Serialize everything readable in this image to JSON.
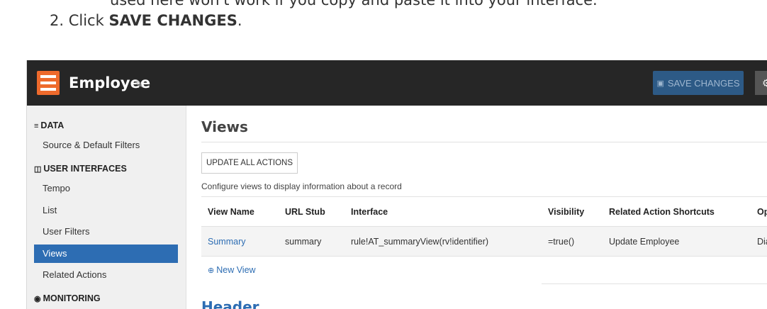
{
  "doc": {
    "cut_line": "used here won't work if you copy and paste it into your interface.",
    "step_number": "2. Click",
    "step_bold": "SAVE CHANGES",
    "step_end": "."
  },
  "app": {
    "title": "Employee",
    "save_label": "SAVE CHANGES",
    "gear_symbol": "⚙"
  },
  "sidebar": {
    "data_head": "DATA",
    "data_items": [
      "Source & Default Filters"
    ],
    "ui_head": "USER INTERFACES",
    "ui_items": [
      "Tempo",
      "List",
      "User Filters",
      "Views",
      "Related Actions"
    ],
    "active": "Views",
    "monitoring_head": "MONITORING"
  },
  "main": {
    "views_title": "Views",
    "update_all_label": "UPDATE ALL ACTIONS",
    "configure_text": "Configure views to display information about a record",
    "columns": [
      "View Name",
      "URL Stub",
      "Interface",
      "Visibility",
      "Related Action Shortcuts",
      "Op"
    ],
    "rows": [
      [
        "Summary",
        "summary",
        "rule!AT_summaryView(rv!identifier)",
        "=true()",
        "Update Employee",
        "Dia"
      ]
    ],
    "new_view_label": "New View",
    "header_title": "Header"
  },
  "colors": {
    "topbar": "#262626",
    "logo": "#ee6a2c",
    "save_button": "#2d5a86",
    "active_item": "#2d6db3",
    "link": "#2d6db3"
  }
}
